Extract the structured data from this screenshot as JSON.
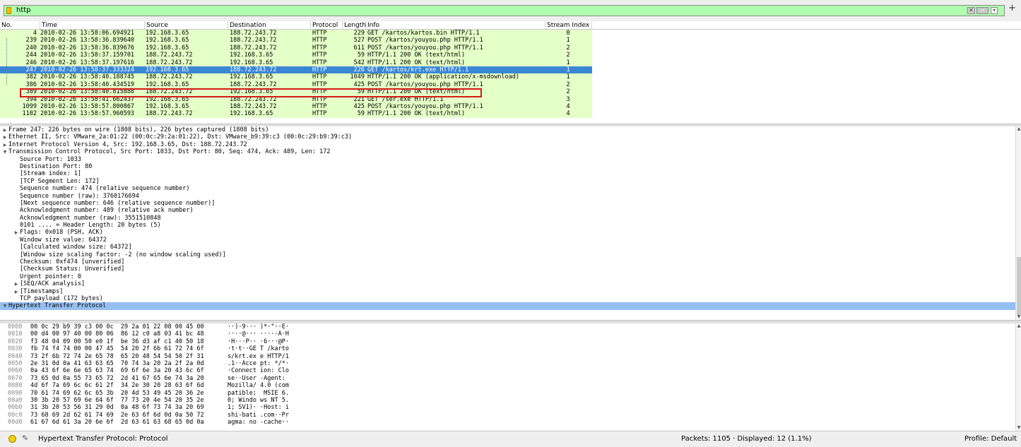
{
  "filter": {
    "value": "http",
    "icons": [
      "bookmark-icon",
      "clear-icon",
      "apply-arrow-icon",
      "history-dropdown-icon",
      "add-button-icon"
    ]
  },
  "columns": [
    {
      "key": "no",
      "label": "No."
    },
    {
      "key": "time",
      "label": "Time"
    },
    {
      "key": "source",
      "label": "Source"
    },
    {
      "key": "destination",
      "label": "Destination"
    },
    {
      "key": "protocol",
      "label": "Protocol"
    },
    {
      "key": "length",
      "label": "Length"
    },
    {
      "key": "info",
      "label": "Info"
    },
    {
      "key": "stream",
      "label": "Stream Index"
    }
  ],
  "packets": [
    {
      "no": "4",
      "time": "2010-02-26 13:58:06.694921",
      "source": "192.168.3.65",
      "destination": "188.72.243.72",
      "protocol": "HTTP",
      "length": "229",
      "info": "GET /kartos/kartos.bin HTTP/1.1",
      "stream": "0",
      "selected": false
    },
    {
      "no": "239",
      "time": "2010-02-26 13:58:36.839640",
      "source": "192.168.3.65",
      "destination": "188.72.243.72",
      "protocol": "HTTP",
      "length": "527",
      "info": "POST /kartos/youyou.php HTTP/1.1",
      "stream": "1",
      "selected": false
    },
    {
      "no": "240",
      "time": "2010-02-26 13:58:36.839676",
      "source": "192.168.3.65",
      "destination": "188.72.243.72",
      "protocol": "HTTP",
      "length": "611",
      "info": "POST /kartos/youyou.php HTTP/1.1",
      "stream": "2",
      "selected": false
    },
    {
      "no": "244",
      "time": "2010-02-26 13:58:37.159701",
      "source": "188.72.243.72",
      "destination": "192.168.3.65",
      "protocol": "HTTP",
      "length": "59",
      "info": "HTTP/1.1 200 OK  (text/html)",
      "stream": "2",
      "selected": false
    },
    {
      "no": "246",
      "time": "2010-02-26 13:58:37.197616",
      "source": "188.72.243.72",
      "destination": "192.168.3.65",
      "protocol": "HTTP",
      "length": "542",
      "info": "HTTP/1.1 200 OK  (text/html)",
      "stream": "1",
      "selected": false
    },
    {
      "no": "247",
      "time": "2010-02-26 13:58:37.333324",
      "source": "192.168.3.65",
      "destination": "188.72.243.72",
      "protocol": "HTTP",
      "length": "226",
      "info": "GET /kartos/krt.exe HTTP/1.1",
      "stream": "1",
      "selected": true
    },
    {
      "no": "382",
      "time": "2010-02-26 13:58:40.188745",
      "source": "188.72.243.72",
      "destination": "192.168.3.65",
      "protocol": "HTTP",
      "length": "1049",
      "info": "HTTP/1.1 200 OK  (application/x-msdownload)",
      "stream": "1",
      "selected": false
    },
    {
      "no": "386",
      "time": "2010-02-26 13:58:40.434519",
      "source": "192.168.3.65",
      "destination": "188.72.243.72",
      "protocol": "HTTP",
      "length": "425",
      "info": "POST /kartos/youyou.php HTTP/1.1",
      "stream": "2",
      "selected": false
    },
    {
      "no": "389",
      "time": "2010-02-26 13:58:40.815888",
      "source": "188.72.243.72",
      "destination": "192.168.3.65",
      "protocol": "HTTP",
      "length": "59",
      "info": "HTTP/1.1 200 OK  (text/html)",
      "stream": "2",
      "selected": false
    },
    {
      "no": "394",
      "time": "2010-02-26 13:58:41.662437",
      "source": "192.168.3.65",
      "destination": "188.72.243.72",
      "protocol": "HTTP",
      "length": "221",
      "info": "GET /ser.exe HTTP/1.1",
      "stream": "3",
      "selected": false
    },
    {
      "no": "1099",
      "time": "2010-02-26 13:58:57.800867",
      "source": "192.168.3.65",
      "destination": "188.72.243.72",
      "protocol": "HTTP",
      "length": "425",
      "info": "POST /kartos/youyou.php HTTP/1.1",
      "stream": "4",
      "selected": false
    },
    {
      "no": "1102",
      "time": "2010-02-26 13:58:57.960593",
      "source": "188.72.243.72",
      "destination": "192.168.3.65",
      "protocol": "HTTP",
      "length": "59",
      "info": "HTTP/1.1 200 OK  (text/html)",
      "stream": "4",
      "selected": false
    }
  ],
  "details": [
    {
      "level": 0,
      "expander": "collapsed",
      "text": "Frame 247: 226 bytes on wire (1808 bits), 226 bytes captured (1808 bits)"
    },
    {
      "level": 0,
      "expander": "collapsed",
      "text": "Ethernet II, Src: VMware_2a:01:22 (00:0c:29:2a:01:22), Dst: VMware_b9:39:c3 (00:0c:29:b9:39:c3)"
    },
    {
      "level": 0,
      "expander": "collapsed",
      "text": "Internet Protocol Version 4, Src: 192.168.3.65, Dst: 188.72.243.72"
    },
    {
      "level": 0,
      "expander": "expanded",
      "text": "Transmission Control Protocol, Src Port: 1033, Dst Port: 80, Seq: 474, Ack: 489, Len: 172"
    },
    {
      "level": 1,
      "expander": "none",
      "text": "Source Port: 1033"
    },
    {
      "level": 1,
      "expander": "none",
      "text": "Destination Port: 80"
    },
    {
      "level": 1,
      "expander": "none",
      "text": "[Stream index: 1]"
    },
    {
      "level": 1,
      "expander": "none",
      "text": "[TCP Segment Len: 172]"
    },
    {
      "level": 1,
      "expander": "none",
      "text": "Sequence number: 474    (relative sequence number)"
    },
    {
      "level": 1,
      "expander": "none",
      "text": "Sequence number (raw): 3760176694"
    },
    {
      "level": 1,
      "expander": "none",
      "text": "[Next sequence number: 646    (relative sequence number)]"
    },
    {
      "level": 1,
      "expander": "none",
      "text": "Acknowledgment number: 489    (relative ack number)"
    },
    {
      "level": 1,
      "expander": "none",
      "text": "Acknowledgment number (raw): 3551510848"
    },
    {
      "level": 1,
      "expander": "none",
      "text": "0101 .... = Header Length: 20 bytes (5)"
    },
    {
      "level": 1,
      "expander": "collapsed",
      "text": "Flags: 0x018 (PSH, ACK)"
    },
    {
      "level": 1,
      "expander": "none",
      "text": "Window size value: 64372"
    },
    {
      "level": 1,
      "expander": "none",
      "text": "[Calculated window size: 64372]"
    },
    {
      "level": 1,
      "expander": "none",
      "text": "[Window size scaling factor: -2 (no window scaling used)]"
    },
    {
      "level": 1,
      "expander": "none",
      "text": "Checksum: 0xf474 [unverified]"
    },
    {
      "level": 1,
      "expander": "none",
      "text": "[Checksum Status: Unverified]"
    },
    {
      "level": 1,
      "expander": "none",
      "text": "Urgent pointer: 0"
    },
    {
      "level": 1,
      "expander": "collapsed",
      "text": "[SEQ/ACK analysis]"
    },
    {
      "level": 1,
      "expander": "collapsed",
      "text": "[Timestamps]"
    },
    {
      "level": 1,
      "expander": "none",
      "text": "TCP payload (172 bytes)"
    },
    {
      "level": 0,
      "expander": "expanded",
      "text": "Hypertext Transfer Protocol",
      "highlight": true
    }
  ],
  "hex_dump": [
    {
      "offset": "0000",
      "hex": "00 0c 29 b9 39 c3 00 0c  29 2a 01 22 08 00 45 00",
      "ascii": "··)·9··· )*·\"··E·"
    },
    {
      "offset": "0010",
      "hex": "00 d4 00 97 40 00 80 06  86 12 c0 a8 03 41 bc 48",
      "ascii": "····@··· ·····A·H"
    },
    {
      "offset": "0020",
      "hex": "f3 48 04 09 00 50 e0 1f  be 36 d3 af c1 40 50 18",
      "ascii": "·H···P·· ·6···@P·"
    },
    {
      "offset": "0030",
      "hex": "fb 74 f4 74 00 00 47 45  54 20 2f 6b 61 72 74 6f",
      "ascii": "·t·t··GE T /karto"
    },
    {
      "offset": "0040",
      "hex": "73 2f 6b 72 74 2e 65 78  65 20 48 54 54 50 2f 31",
      "ascii": "s/krt.ex e HTTP/1"
    },
    {
      "offset": "0050",
      "hex": "2e 31 0d 0a 41 63 63 65  70 74 3a 20 2a 2f 2a 0d",
      "ascii": ".1··Acce pt: */*·"
    },
    {
      "offset": "0060",
      "hex": "0a 43 6f 6e 6e 65 63 74  69 6f 6e 3a 20 43 6c 6f",
      "ascii": "·Connect ion: Clo"
    },
    {
      "offset": "0070",
      "hex": "73 65 0d 0a 55 73 65 72  2d 41 67 65 6e 74 3a 20",
      "ascii": "se··User -Agent: "
    },
    {
      "offset": "0080",
      "hex": "4d 6f 7a 69 6c 6c 61 2f  34 2e 30 20 28 63 6f 6d",
      "ascii": "Mozilla/ 4.0 (com"
    },
    {
      "offset": "0090",
      "hex": "70 61 74 69 62 6c 65 3b  20 4d 53 49 45 20 36 2e",
      "ascii": "patible;  MSIE 6."
    },
    {
      "offset": "00a0",
      "hex": "30 3b 20 57 69 6e 64 6f  77 73 20 4e 54 20 35 2e",
      "ascii": "0; Windo ws NT 5."
    },
    {
      "offset": "00b0",
      "hex": "31 3b 20 53 56 31 29 0d  0a 48 6f 73 74 3a 20 69",
      "ascii": "1; SV1)· ·Host: i"
    },
    {
      "offset": "00c0",
      "hex": "73 68 69 2d 62 61 74 69  2e 63 6f 6d 0d 0a 50 72",
      "ascii": "shi-bati .com··Pr"
    },
    {
      "offset": "00d0",
      "hex": "61 67 6d 61 3a 20 6e 6f  2d 63 61 63 68 65 0d 0a",
      "ascii": "agma: no -cache··"
    }
  ],
  "status": {
    "field": "Hypertext Transfer Protocol: Protocol",
    "packets": "Packets: 1105 · Displayed: 12 (1.1%)",
    "profile": "Profile: Default"
  },
  "colors": {
    "filter_valid": "#afffaf",
    "http_row": "#e4ffc7",
    "selected_row": "#3a87d6",
    "highlight_detail": "#95bff1",
    "selection_outline": "#d81818"
  }
}
